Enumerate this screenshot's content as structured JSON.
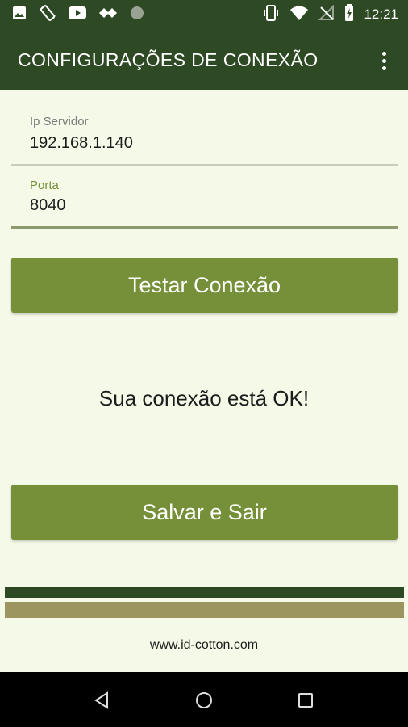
{
  "status_bar": {
    "time": "12:21",
    "left_icons": [
      "image-icon",
      "screen-rotation-icon",
      "youtube-icon",
      "app-icon",
      "dot-icon"
    ],
    "right_icons": [
      "vibrate-icon",
      "wifi-icon",
      "no-signal-icon",
      "battery-charging-icon"
    ]
  },
  "app_bar": {
    "title": "CONFIGURAÇÕES DE CONEXÃO",
    "menu_icon": "more-vert-icon"
  },
  "form": {
    "ip": {
      "label": "Ip Servidor",
      "value": "192.168.1.140"
    },
    "port": {
      "label": "Porta",
      "value": "8040"
    }
  },
  "buttons": {
    "test": "Testar Conexão",
    "save": "Salvar e Sair"
  },
  "status_message": "Sua conexão está OK!",
  "footer": {
    "website": "www.id-cotton.com"
  },
  "nav_bar": {
    "icons": [
      "back-icon",
      "home-icon",
      "recent-apps-icon"
    ]
  },
  "colors": {
    "app_bar": "#2e4a25",
    "accent": "#76903a",
    "background": "#f5fae8",
    "stripe_tan": "#9d9560"
  }
}
